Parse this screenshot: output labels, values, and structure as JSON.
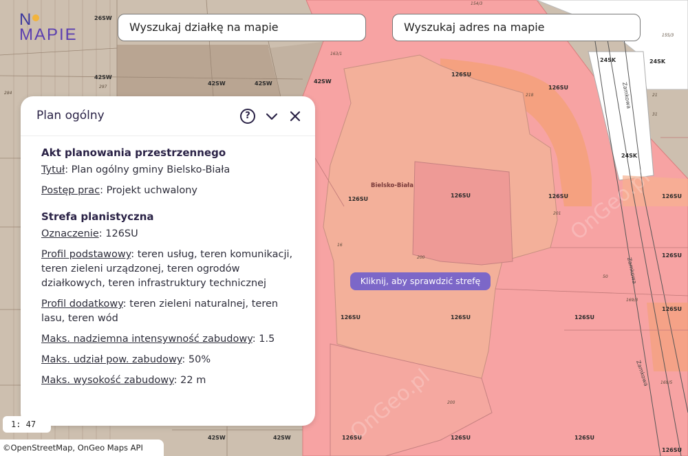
{
  "logo": {
    "top": "N",
    "top_after": "",
    "bottom": "MAPIE"
  },
  "search": {
    "parcel_placeholder": "Wyszukaj działkę na mapie",
    "address_placeholder": "Wyszukaj adres na mapie"
  },
  "panel": {
    "title": "Plan ogólny",
    "help_glyph": "?",
    "act": {
      "heading": "Akt planowania przestrzennego",
      "title_key": "Tytuł",
      "title_value": ": Plan ogólny gminy Bielsko-Biała",
      "progress_key": "Postęp prac",
      "progress_value": ": Projekt uchwalony"
    },
    "zone": {
      "heading": "Strefa planistyczna",
      "designation_key": "Oznaczenie",
      "designation_value": ": 126SU",
      "base_profile_key": "Profil podstawowy",
      "base_profile_value": ": teren usług, teren komunikacji, teren zieleni urządzonej, teren ogrodów działkowych, teren infrastruktury technicznej",
      "extra_profile_key": "Profil dodatkowy",
      "extra_profile_value": ": teren zieleni naturalnej, teren lasu, teren wód",
      "intensity_key": "Maks. nadziemna intensywność zabudowy",
      "intensity_value": ": 1.5",
      "coverage_key": "Maks. udział pow. zabudowy",
      "coverage_value": ": 50%",
      "height_key": "Maks. wysokość zabudowy",
      "height_value": ": 22 m"
    }
  },
  "map": {
    "tooltip": "Kliknij, aby sprawdzić strefę",
    "place_name": "Bielsko-Biała",
    "street_name": "Zamkowa",
    "watermark": "OnGeo.pl",
    "scale": "1: 47",
    "attribution": "©OpenStreetMap, OnGeo Maps API",
    "zone_labels": {
      "su": "126SU",
      "sw": "42SW",
      "sk": "24SK",
      "sw_b": "26SW"
    },
    "parcel_numbers": [
      "16",
      "200",
      "201",
      "218",
      "50",
      "169/3",
      "31",
      "21",
      "155/3",
      "284",
      "297",
      "163/1",
      "154/3",
      "169/5"
    ],
    "colors": {
      "zone_su": "#f7a3a3",
      "zone_su_dark": "#ee9191",
      "building": "#f3b09a",
      "road_orange": "#f4a17a",
      "zone_sw": "#cbbba9",
      "zone_sk": "#ffffff",
      "accent": "#7c67c8"
    }
  }
}
